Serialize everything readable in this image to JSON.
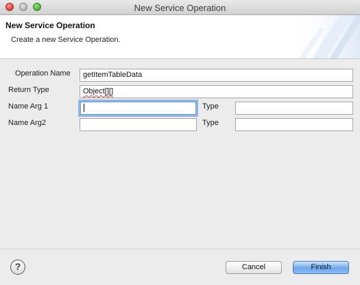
{
  "window": {
    "title": "New Service Operation"
  },
  "header": {
    "title": "New Service Operation",
    "description": "Create a new Service Operation."
  },
  "form": {
    "operation_name": {
      "label": "Operation Name",
      "value": "getItemTableData"
    },
    "return_type": {
      "label": "Return Type",
      "value": "Object[][]"
    },
    "arg1": {
      "name_label": "Name Arg 1",
      "name_value": "",
      "type_label": "Type",
      "type_value": ""
    },
    "arg2": {
      "name_label": "Name Arg2",
      "name_value": "",
      "type_label": "Type",
      "type_value": ""
    }
  },
  "footer": {
    "help_symbol": "?",
    "cancel_label": "Cancel",
    "finish_label": "Finish"
  },
  "colors": {
    "focus_ring": "#8fb7e6",
    "default_button": "#6ea8ea"
  },
  "icons": {
    "help": "help-icon",
    "close": "close-window-icon",
    "minimize": "minimize-window-icon",
    "zoom": "zoom-window-icon",
    "banner": "wizard-banner-image"
  }
}
